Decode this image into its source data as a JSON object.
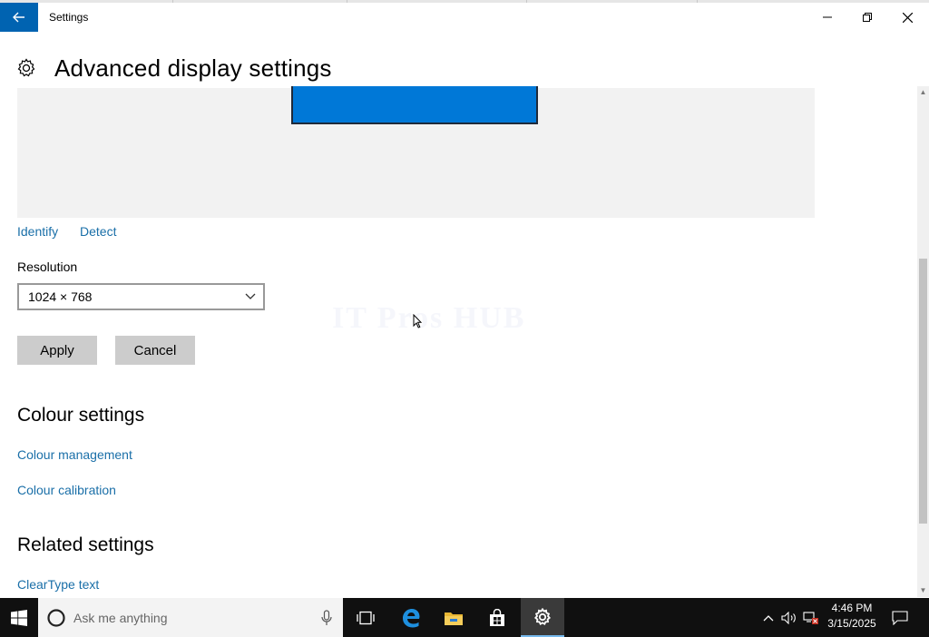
{
  "window": {
    "title": "Settings",
    "controls": {
      "minimize": "minimize-icon",
      "maximize": "restore-icon",
      "close": "close-icon"
    }
  },
  "page": {
    "icon": "gear-icon",
    "title": "Advanced display settings"
  },
  "display_preview": {
    "links": {
      "identify": "Identify",
      "detect": "Detect"
    }
  },
  "resolution": {
    "label": "Resolution",
    "value": "1024 × 768"
  },
  "buttons": {
    "apply": "Apply",
    "cancel": "Cancel"
  },
  "colour_settings": {
    "heading": "Colour settings",
    "links": [
      "Colour management",
      "Colour calibration"
    ]
  },
  "related_settings": {
    "heading": "Related settings",
    "links": [
      "ClearType text"
    ]
  },
  "watermark": "IT Pros HUB",
  "taskbar": {
    "search_placeholder": "Ask me anything",
    "time": "4:46 PM",
    "date": "3/15/2025"
  },
  "colors": {
    "accent": "#0063b1",
    "monitor": "#0078d7",
    "link": "#1a6fa8"
  }
}
